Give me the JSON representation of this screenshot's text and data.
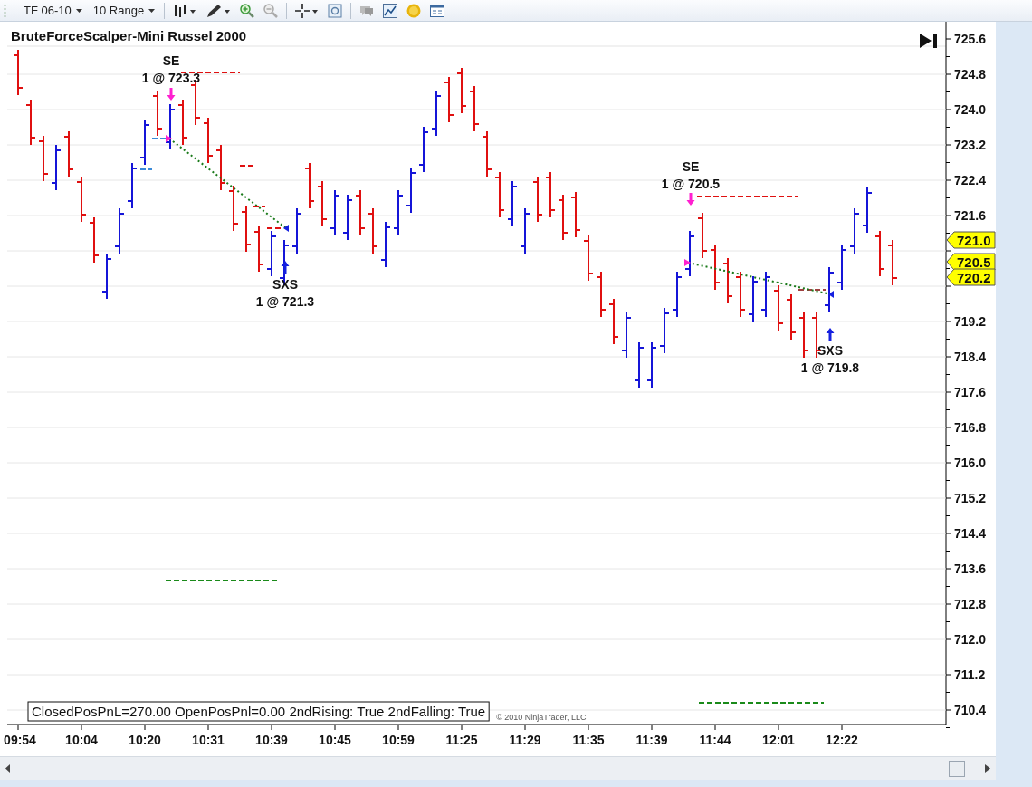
{
  "toolbar": {
    "instrument": "TF 06-10",
    "period": "10 Range"
  },
  "chart": {
    "title": "BruteForceScalper-Mini Russel 2000",
    "y_axis_upper": [
      "725.6",
      "724.8",
      "724.0",
      "723.2",
      "722.4",
      "721.6"
    ],
    "y_axis_lower": [
      "719.2",
      "718.4",
      "717.6",
      "716.8",
      "716.0",
      "715.2",
      "714.4",
      "713.6",
      "712.8",
      "712.0",
      "711.2",
      "710.4"
    ],
    "x_axis": [
      "09:54",
      "10:04",
      "10:20",
      "10:31",
      "10:39",
      "10:45",
      "10:59",
      "11:25",
      "11:29",
      "11:35",
      "11:39",
      "11:44",
      "12:01",
      "12:22"
    ],
    "trades": [
      {
        "kind": "entry",
        "label": "SE",
        "fill": "1 @ 723.3"
      },
      {
        "kind": "exit",
        "label": "SXS",
        "fill": "1 @ 721.3"
      },
      {
        "kind": "entry",
        "label": "SE",
        "fill": "1 @ 720.5"
      },
      {
        "kind": "exit",
        "label": "SXS",
        "fill": "1 @ 719.8"
      }
    ],
    "price_tags": [
      "721.0",
      "720.5",
      "720.2"
    ],
    "status_text": "ClosedPosPnL=270.00 OpenPosPnl=0.00 2ndRising: True 2ndFalling: True",
    "copyright": "© 2010 NinjaTrader, LLC"
  }
}
